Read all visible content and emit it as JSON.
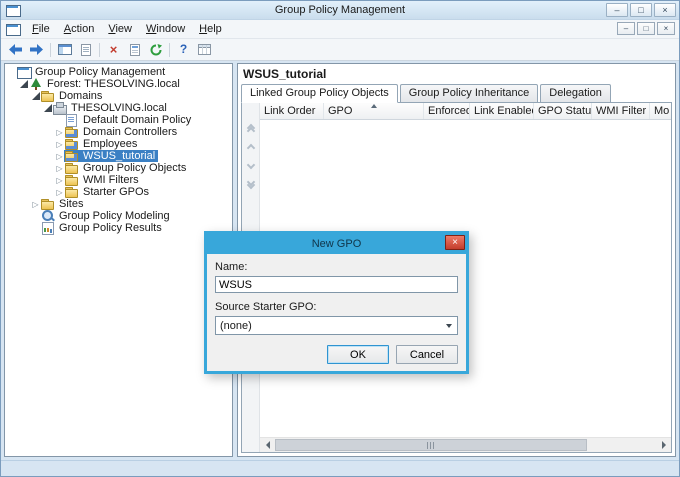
{
  "window": {
    "title": "Group Policy Management",
    "caption": {
      "minimize": "–",
      "maximize": "□",
      "close": "×"
    }
  },
  "menubar": {
    "items": [
      "File",
      "Action",
      "View",
      "Window",
      "Help"
    ],
    "child_caption": {
      "minimize": "–",
      "restore": "□",
      "close": "×"
    }
  },
  "toolbar": {
    "icons": [
      {
        "name": "back",
        "glyph": ""
      },
      {
        "name": "forward",
        "glyph": ""
      },
      {
        "name": "show-console-tree",
        "glyph": ""
      },
      {
        "name": "export-list",
        "glyph": ""
      },
      {
        "name": "delete",
        "glyph": "×"
      },
      {
        "name": "properties",
        "glyph": ""
      },
      {
        "name": "refresh",
        "glyph": ""
      },
      {
        "name": "help",
        "glyph": "?"
      },
      {
        "name": "columns",
        "glyph": ""
      }
    ]
  },
  "tree": {
    "items": [
      {
        "label": "Group Policy Management",
        "level": 0,
        "icon": "console",
        "expander": "none",
        "selected": false
      },
      {
        "label": "Forest: THESOLVING.local",
        "level": 1,
        "icon": "forest",
        "expander": "expanded",
        "selected": false
      },
      {
        "label": "Domains",
        "level": 2,
        "icon": "folder",
        "expander": "expanded",
        "selected": false
      },
      {
        "label": "THESOLVING.local",
        "level": 3,
        "icon": "domain",
        "expander": "expanded",
        "selected": false
      },
      {
        "label": "Default Domain Policy",
        "level": 4,
        "icon": "gpo",
        "expander": "none",
        "selected": false
      },
      {
        "label": "Domain Controllers",
        "level": 4,
        "icon": "ou",
        "expander": "collapsed",
        "selected": false
      },
      {
        "label": "Employees",
        "level": 4,
        "icon": "ou",
        "expander": "collapsed",
        "selected": false
      },
      {
        "label": "WSUS_tutorial",
        "level": 4,
        "icon": "ou",
        "expander": "collapsed",
        "selected": true
      },
      {
        "label": "Group Policy Objects",
        "level": 4,
        "icon": "folder",
        "expander": "collapsed",
        "selected": false
      },
      {
        "label": "WMI Filters",
        "level": 4,
        "icon": "folder",
        "expander": "collapsed",
        "selected": false
      },
      {
        "label": "Starter GPOs",
        "level": 4,
        "icon": "folder",
        "expander": "collapsed",
        "selected": false
      },
      {
        "label": "Sites",
        "level": 2,
        "icon": "folder",
        "expander": "collapsed",
        "selected": false
      },
      {
        "label": "Group Policy Modeling",
        "level": 2,
        "icon": "modeling",
        "expander": "none",
        "selected": false
      },
      {
        "label": "Group Policy Results",
        "level": 2,
        "icon": "results",
        "expander": "none",
        "selected": false
      }
    ]
  },
  "main": {
    "title": "WSUS_tutorial",
    "tabs": [
      {
        "label": "Linked Group Policy Objects",
        "active": true
      },
      {
        "label": "Group Policy Inheritance",
        "active": false
      },
      {
        "label": "Delegation",
        "active": false
      }
    ],
    "table": {
      "columns": [
        "Link Order",
        "GPO",
        "Enforced",
        "Link Enabled",
        "GPO Status",
        "WMI Filter",
        "Mo"
      ],
      "sort_column": "GPO",
      "sort_direction": "ascending",
      "rows": []
    }
  },
  "dialog": {
    "title": "New GPO",
    "close": "×",
    "name_label": "Name:",
    "name_value": "WSUS",
    "source_label": "Source Starter GPO:",
    "source_value": "(none)",
    "buttons": {
      "ok": "OK",
      "cancel": "Cancel"
    }
  },
  "colors": {
    "dialog_accent": "#38a7da",
    "dialog_close_red": "#c33d2c",
    "selection_blue": "#3b80c4",
    "frame_blue": "#d7e5f2"
  }
}
